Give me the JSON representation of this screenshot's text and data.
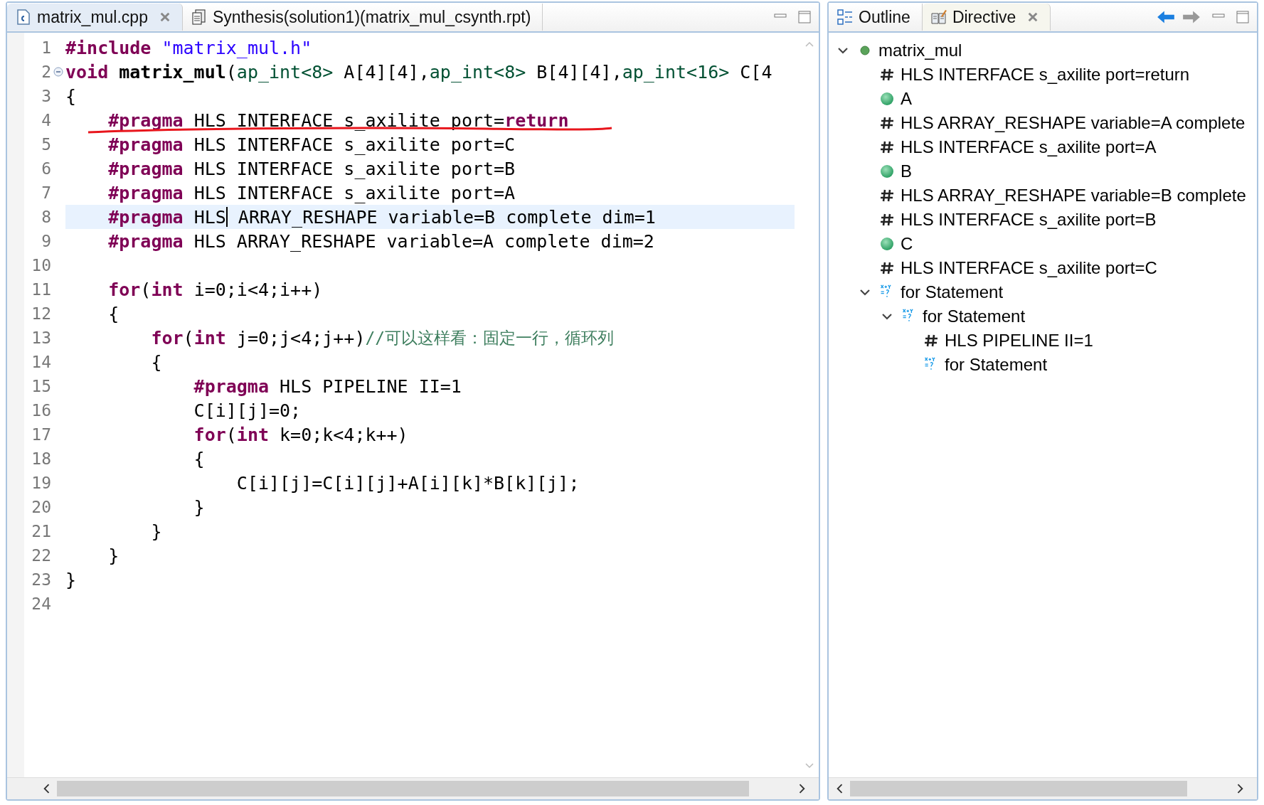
{
  "editor": {
    "tabs": [
      {
        "label": "matrix_mul.cpp",
        "selected": true,
        "closable": true
      },
      {
        "label": "Synthesis(solution1)(matrix_mul_csynth.rpt)",
        "selected": false,
        "closable": false
      }
    ],
    "lines": [
      {
        "number": "1",
        "tokens": [
          {
            "kind": "kw",
            "text": "#include "
          },
          {
            "kind": "str",
            "text": "\"matrix_mul.h\""
          }
        ]
      },
      {
        "number": "2",
        "folding": true,
        "tokens": [
          {
            "kind": "kw",
            "text": "void "
          },
          {
            "kind": "fn",
            "text": "matrix_mul"
          },
          {
            "kind": "plain",
            "text": "("
          },
          {
            "kind": "type",
            "text": "ap_int<8>"
          },
          {
            "kind": "plain",
            "text": " A[4][4],"
          },
          {
            "kind": "type",
            "text": "ap_int<8>"
          },
          {
            "kind": "plain",
            "text": " B[4][4],"
          },
          {
            "kind": "type",
            "text": "ap_int<16>"
          },
          {
            "kind": "plain",
            "text": " C[4"
          }
        ]
      },
      {
        "number": "3",
        "tokens": [
          {
            "kind": "plain",
            "text": "{"
          }
        ]
      },
      {
        "number": "4",
        "underlined": true,
        "tokens": [
          {
            "kind": "kw",
            "text": "    #pragma"
          },
          {
            "kind": "plain",
            "text": " HLS INTERFACE s_axilite port="
          },
          {
            "kind": "kw",
            "text": "return"
          }
        ]
      },
      {
        "number": "5",
        "tokens": [
          {
            "kind": "kw",
            "text": "    #pragma"
          },
          {
            "kind": "plain",
            "text": " HLS INTERFACE s_axilite port=C"
          }
        ]
      },
      {
        "number": "6",
        "tokens": [
          {
            "kind": "kw",
            "text": "    #pragma"
          },
          {
            "kind": "plain",
            "text": " HLS INTERFACE s_axilite port=B"
          }
        ]
      },
      {
        "number": "7",
        "tokens": [
          {
            "kind": "kw",
            "text": "    #pragma"
          },
          {
            "kind": "plain",
            "text": " HLS INTERFACE s_axilite port=A"
          }
        ]
      },
      {
        "number": "8",
        "current": true,
        "tokens": [
          {
            "kind": "kw",
            "text": "    #pragma"
          },
          {
            "kind": "plain",
            "text": " HLS"
          },
          {
            "kind": "cursor"
          },
          {
            "kind": "plain",
            "text": " ARRAY_RESHAPE variable=B complete dim=1"
          }
        ]
      },
      {
        "number": "9",
        "tokens": [
          {
            "kind": "kw",
            "text": "    #pragma"
          },
          {
            "kind": "plain",
            "text": " HLS ARRAY_RESHAPE variable=A complete dim=2"
          }
        ]
      },
      {
        "number": "10"
      },
      {
        "number": "11",
        "tokens": [
          {
            "kind": "kw",
            "text": "    for"
          },
          {
            "kind": "plain",
            "text": "("
          },
          {
            "kind": "kw",
            "text": "int"
          },
          {
            "kind": "plain",
            "text": " i=0;i<4;i++)"
          }
        ]
      },
      {
        "number": "12",
        "tokens": [
          {
            "kind": "plain",
            "text": "    {"
          }
        ]
      },
      {
        "number": "13",
        "tokens": [
          {
            "kind": "kw",
            "text": "        for"
          },
          {
            "kind": "plain",
            "text": "("
          },
          {
            "kind": "kw",
            "text": "int"
          },
          {
            "kind": "plain",
            "text": " j=0;j<4;j++)"
          },
          {
            "kind": "comment",
            "text": "//可以这样看：固定一行，循环列"
          }
        ]
      },
      {
        "number": "14",
        "tokens": [
          {
            "kind": "plain",
            "text": "        {"
          }
        ]
      },
      {
        "number": "15",
        "tokens": [
          {
            "kind": "kw",
            "text": "            #pragma"
          },
          {
            "kind": "plain",
            "text": " HLS PIPELINE II=1"
          }
        ]
      },
      {
        "number": "16",
        "tokens": [
          {
            "kind": "plain",
            "text": "            C[i][j]=0;"
          }
        ]
      },
      {
        "number": "17",
        "tokens": [
          {
            "kind": "kw",
            "text": "            for"
          },
          {
            "kind": "plain",
            "text": "("
          },
          {
            "kind": "kw",
            "text": "int"
          },
          {
            "kind": "plain",
            "text": " k=0;k<4;k++)"
          }
        ]
      },
      {
        "number": "18",
        "tokens": [
          {
            "kind": "plain",
            "text": "            {"
          }
        ]
      },
      {
        "number": "19",
        "tokens": [
          {
            "kind": "plain",
            "text": "                C[i][j]=C[i][j]+A[i][k]*B[k][j];"
          }
        ]
      },
      {
        "number": "20",
        "tokens": [
          {
            "kind": "plain",
            "text": "            }"
          }
        ]
      },
      {
        "number": "21",
        "tokens": [
          {
            "kind": "plain",
            "text": "        }"
          }
        ]
      },
      {
        "number": "22",
        "tokens": [
          {
            "kind": "plain",
            "text": "    }"
          }
        ]
      },
      {
        "number": "23",
        "tokens": [
          {
            "kind": "plain",
            "text": "}"
          }
        ]
      },
      {
        "number": "24"
      }
    ]
  },
  "side_panel": {
    "tabs": [
      {
        "label": "Outline",
        "selected": false,
        "closable": false
      },
      {
        "label": "Directive",
        "selected": true,
        "closable": true
      }
    ],
    "tree": [
      {
        "kind": "function",
        "label": "matrix_mul",
        "expanded": true,
        "children": [
          {
            "kind": "directive",
            "label": "HLS INTERFACE s_axilite port=return"
          },
          {
            "kind": "variable",
            "label": "A"
          },
          {
            "kind": "directive",
            "label": "HLS ARRAY_RESHAPE variable=A complete"
          },
          {
            "kind": "directive",
            "label": "HLS INTERFACE s_axilite port=A"
          },
          {
            "kind": "variable",
            "label": "B"
          },
          {
            "kind": "directive",
            "label": "HLS ARRAY_RESHAPE variable=B complete"
          },
          {
            "kind": "directive",
            "label": "HLS INTERFACE s_axilite port=B"
          },
          {
            "kind": "variable",
            "label": "C"
          },
          {
            "kind": "directive",
            "label": "HLS INTERFACE s_axilite port=C"
          },
          {
            "kind": "loop",
            "label": "for Statement",
            "expanded": true,
            "children": [
              {
                "kind": "loop",
                "label": "for Statement",
                "expanded": true,
                "children": [
                  {
                    "kind": "directive",
                    "label": "HLS PIPELINE II=1"
                  },
                  {
                    "kind": "loop",
                    "label": "for Statement"
                  }
                ]
              }
            ]
          }
        ]
      }
    ]
  }
}
